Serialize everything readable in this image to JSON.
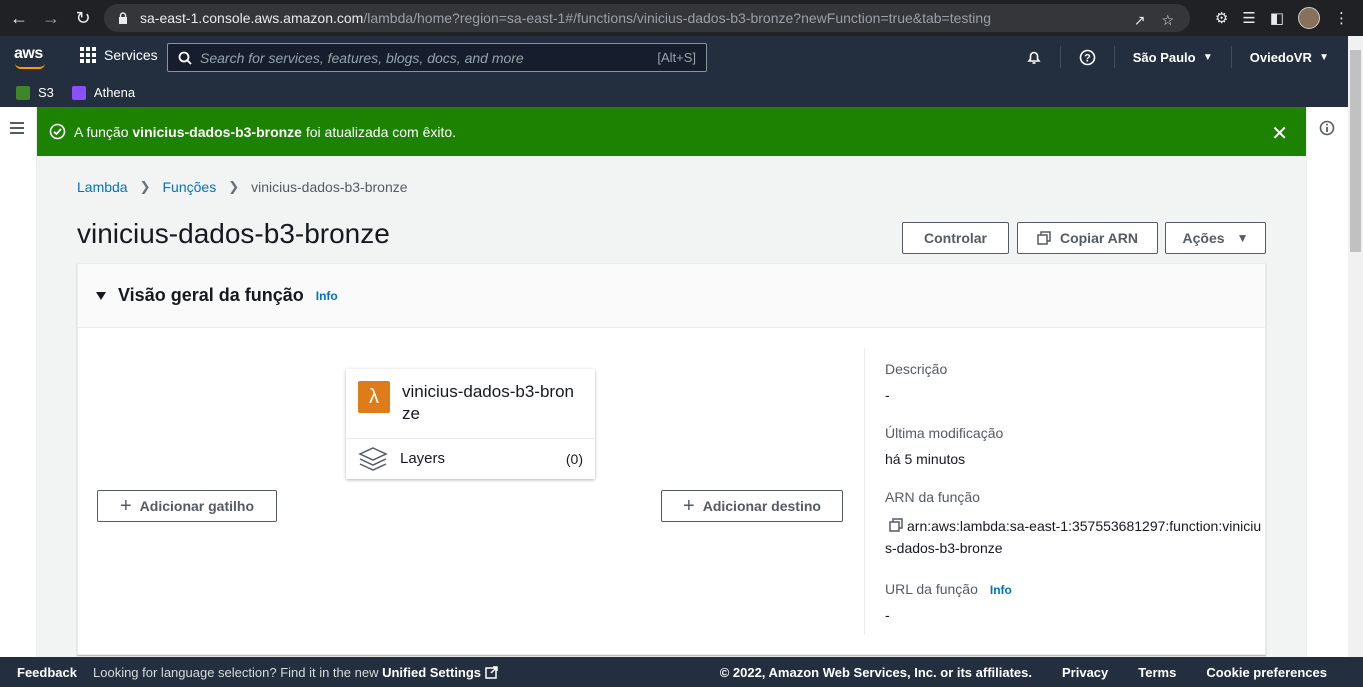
{
  "browser": {
    "url_host": "sa-east-1.console.aws.amazon.com",
    "url_path": "/lambda/home?region=sa-east-1#/functions/vinicius-dados-b3-bronze?newFunction=true&tab=testing"
  },
  "header": {
    "logo": "aws",
    "services_label": "Services",
    "search_placeholder": "Search for services, features, blogs, docs, and more",
    "search_shortcut": "[Alt+S]",
    "region": "São Paulo",
    "account": "OviedoVR"
  },
  "favorites": [
    {
      "label": "S3",
      "color": "#3f8624"
    },
    {
      "label": "Athena",
      "color": "#8c4fff"
    }
  ],
  "flash": {
    "prefix": "A função",
    "function_name": "vinicius-dados-b3-bronze",
    "suffix": "foi atualizada com êxito.",
    "color": "#1d8102"
  },
  "breadcrumb": [
    "Lambda",
    "Funções",
    "vinicius-dados-b3-bronze"
  ],
  "page_title": "vinicius-dados-b3-bronze",
  "actions": {
    "control": "Controlar",
    "copy_arn": "Copiar ARN",
    "actions": "Ações"
  },
  "overview": {
    "title": "Visão geral da função",
    "info": "Info",
    "function_card_name": "vinicius-dados-b3-bronze",
    "layers_label": "Layers",
    "layers_count": "(0)",
    "add_trigger": "Adicionar gatilho",
    "add_destination": "Adicionar destino",
    "description_label": "Descrição",
    "description_value": "-",
    "last_modified_label": "Última modificação",
    "last_modified_value": "há 5 minutos",
    "arn_label": "ARN da função",
    "arn_value": "arn:aws:lambda:sa-east-1:357553681297:function:vinicius-dados-b3-bronze",
    "url_label": "URL da função",
    "url_info": "Info",
    "url_value": "-"
  },
  "footer": {
    "feedback": "Feedback",
    "language_text": "Looking for language selection? Find it in the new",
    "unified_settings": "Unified Settings",
    "copyright": "© 2022, Amazon Web Services, Inc. or its affiliates.",
    "privacy": "Privacy",
    "terms": "Terms",
    "cookie": "Cookie preferences"
  }
}
